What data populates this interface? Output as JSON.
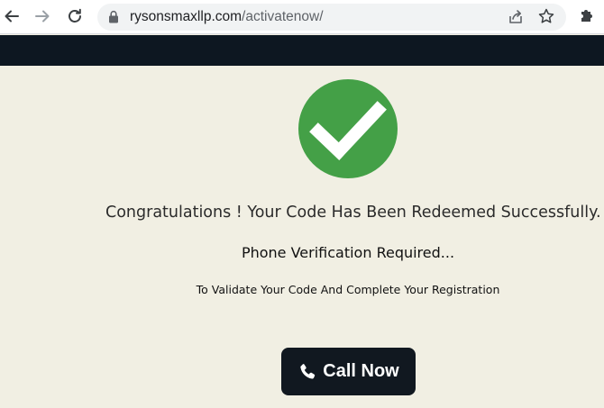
{
  "browser": {
    "url_domain": "rysonsmaxllp.com",
    "url_path": "/activatenow/"
  },
  "icons": {
    "back": "back-arrow-icon",
    "forward": "forward-arrow-icon",
    "reload": "reload-icon",
    "lock": "lock-icon",
    "share": "share-icon",
    "bookmark": "star-icon",
    "extensions": "puzzle-icon",
    "success": "checkmark-circle-icon",
    "call": "phone-icon"
  },
  "colors": {
    "page_background": "#f1efe3",
    "header_band": "#0d1721",
    "success_green": "#44a047",
    "button_background": "#111820"
  },
  "main": {
    "congrats_text": "Congratulations ! Your Code Has Been Redeemed Successfully.",
    "phone_required": "Phone Verification Required...",
    "validate_text": "To Validate Your Code And Complete Your Registration",
    "call_button_label": "Call Now"
  }
}
